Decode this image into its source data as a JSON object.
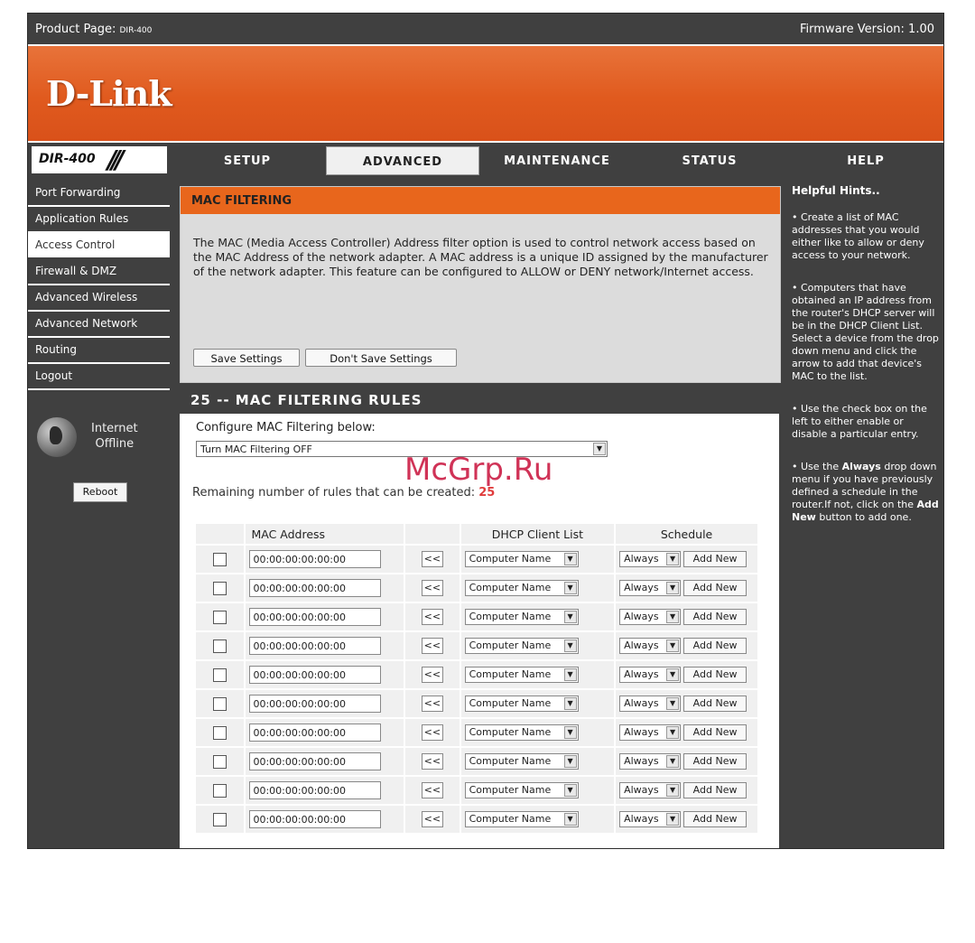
{
  "header": {
    "product_label": "Product Page:",
    "product_model": "DIR-400",
    "firmware": "Firmware Version: 1.00",
    "logo": "D-Link"
  },
  "model_badge": "DIR-400",
  "tabs": [
    {
      "label": "SETUP"
    },
    {
      "label": "ADVANCED"
    },
    {
      "label": "MAINTENANCE"
    },
    {
      "label": "STATUS"
    },
    {
      "label": "HELP"
    }
  ],
  "sidebar": {
    "items": [
      {
        "label": "Port Forwarding"
      },
      {
        "label": "Application Rules"
      },
      {
        "label": "Access Control"
      },
      {
        "label": "Firewall & DMZ"
      },
      {
        "label": "Advanced Wireless"
      },
      {
        "label": "Advanced Network"
      },
      {
        "label": "Routing"
      },
      {
        "label": "Logout"
      }
    ],
    "status_line1": "Internet",
    "status_line2": "Offline",
    "reboot_label": "Reboot"
  },
  "mac_filtering": {
    "title": "MAC FILTERING",
    "description": "The MAC (Media Access Controller) Address filter option is used to control network access based on the MAC Address of the network adapter. A MAC address is a unique ID assigned by the manufacturer of the network adapter. This feature can be configured to ALLOW or DENY network/Internet access.",
    "save_label": "Save Settings",
    "dont_save_label": "Don't Save Settings"
  },
  "rules": {
    "title": "25 -- MAC FILTERING RULES",
    "configure_label": "Configure MAC Filtering below:",
    "mode_value": "Turn MAC Filtering OFF",
    "remaining_label": "Remaining number of rules that can be created:",
    "remaining_count": "25",
    "columns": {
      "mac": "MAC Address",
      "dhcp": "DHCP Client List",
      "schedule": "Schedule"
    },
    "row_values": {
      "mac": "00:00:00:00:00:00",
      "arrow": "<<",
      "dhcp": "Computer Name",
      "schedule": "Always",
      "add_new": "Add New"
    },
    "row_count": 10
  },
  "help": {
    "title": "Helpful Hints..",
    "hint1": "• Create a list of MAC addresses that you would either like to allow or deny access to your network.",
    "hint2": "• Computers that have obtained an IP address from the router's DHCP server will be in the DHCP Client List. Select a device from the drop down menu and click the arrow to add that device's MAC to the list.",
    "hint3": "• Use the check box on the left to either enable or disable a particular entry.",
    "hint4_pre": "• Use the ",
    "hint4_b1": "Always",
    "hint4_mid": " drop down menu if you have previously defined a schedule in the router.If not, click on the ",
    "hint4_b2": "Add New",
    "hint4_post": " button to add one."
  },
  "watermark": "McGrp.Ru"
}
